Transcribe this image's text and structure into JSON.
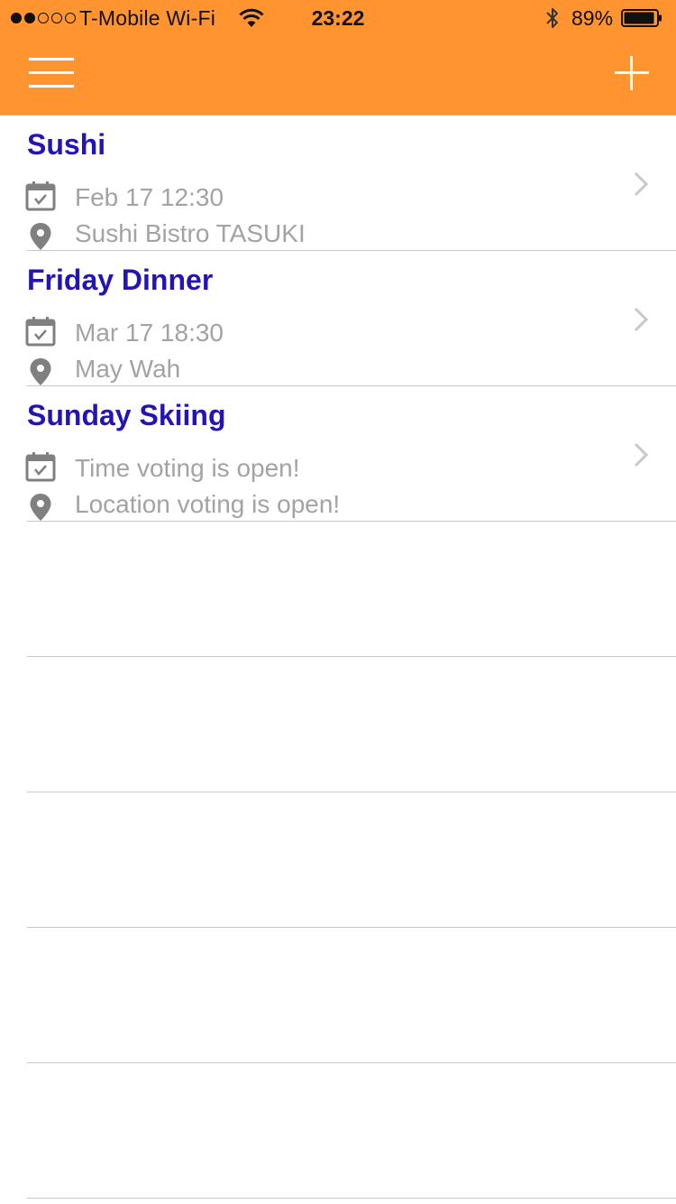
{
  "status_bar": {
    "carrier": "T-Mobile Wi-Fi",
    "time": "23:22",
    "battery": "89%"
  },
  "nav": {
    "menu_icon": "hamburger-menu-icon",
    "add_icon": "plus-icon",
    "bar_color": "#FF9431"
  },
  "events": [
    {
      "title": "Sushi",
      "time": "Feb 17 12:30",
      "location": "Sushi Bistro TASUKI"
    },
    {
      "title": "Friday Dinner",
      "time": "Mar 17 18:30",
      "location": "May Wah"
    },
    {
      "title": "Sunday Skiing",
      "time": "Time voting is open!",
      "location": "Location voting is open!"
    }
  ],
  "colors": {
    "title": "#2414B4",
    "secondary_text": "#A3A3A3",
    "icon": "#808080",
    "separator": "#C9C9C9"
  }
}
